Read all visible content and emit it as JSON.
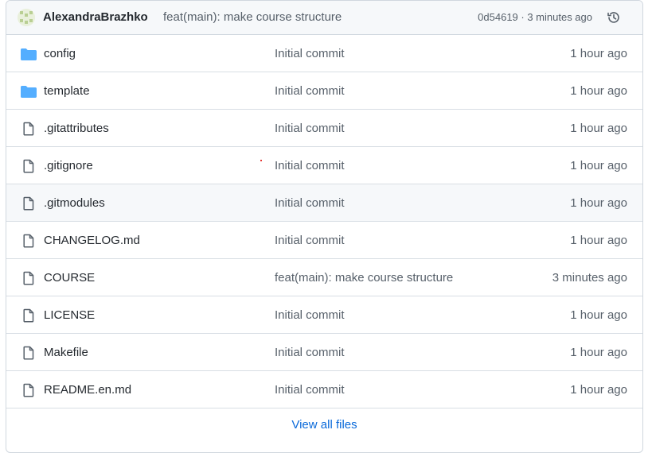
{
  "commit": {
    "author": "AlexandraBrazhko",
    "message": "feat(main): make course structure",
    "sha_time": "0d54619 · 3 minutes ago"
  },
  "files": [
    {
      "name": "config",
      "type": "folder",
      "message": "Initial commit",
      "age": "1 hour ago"
    },
    {
      "name": "template",
      "type": "folder",
      "message": "Initial commit",
      "age": "1 hour ago"
    },
    {
      "name": ".gitattributes",
      "type": "file",
      "message": "Initial commit",
      "age": "1 hour ago"
    },
    {
      "name": ".gitignore",
      "type": "file",
      "message": "Initial commit",
      "age": "1 hour ago"
    },
    {
      "name": ".gitmodules",
      "type": "file",
      "message": "Initial commit",
      "age": "1 hour ago"
    },
    {
      "name": "CHANGELOG.md",
      "type": "file",
      "message": "Initial commit",
      "age": "1 hour ago"
    },
    {
      "name": "COURSE",
      "type": "file",
      "message": "feat(main): make course structure",
      "age": "3 minutes ago"
    },
    {
      "name": "LICENSE",
      "type": "file",
      "message": "Initial commit",
      "age": "1 hour ago"
    },
    {
      "name": "Makefile",
      "type": "file",
      "message": "Initial commit",
      "age": "1 hour ago"
    },
    {
      "name": "README.en.md",
      "type": "file",
      "message": "Initial commit",
      "age": "1 hour ago"
    }
  ],
  "footer": {
    "view_all": "View all files"
  },
  "colors": {
    "folder": "#54aeff",
    "link": "#0969da",
    "hover_row": "#f6f8fa"
  }
}
